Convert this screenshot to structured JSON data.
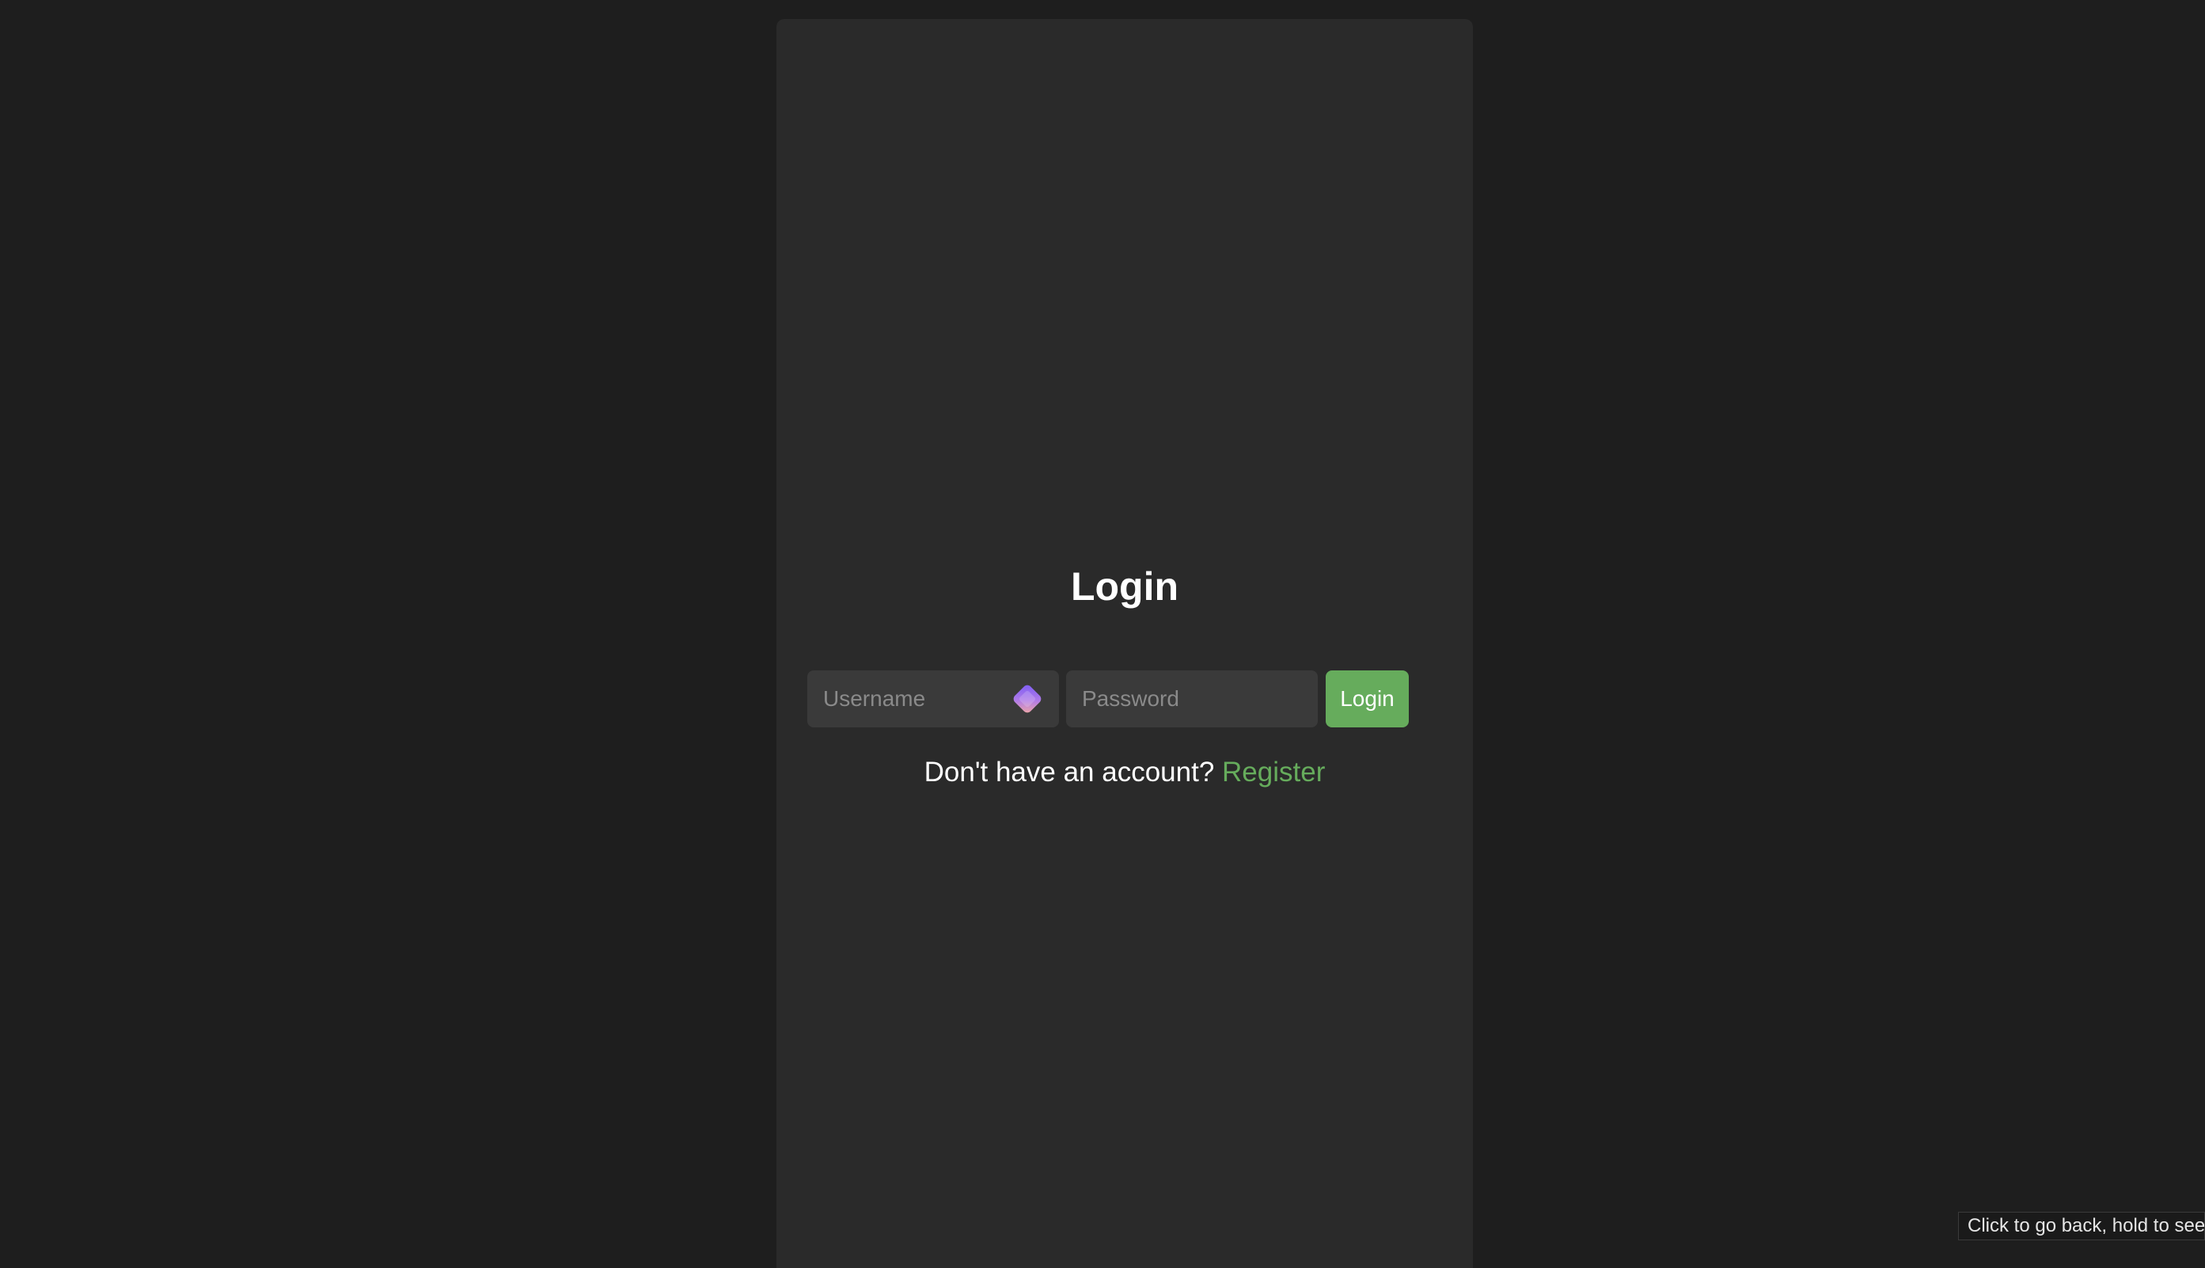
{
  "login": {
    "title": "Login",
    "username_placeholder": "Username",
    "password_placeholder": "Password",
    "submit_label": "Login",
    "register_prompt": "Don't have an account?",
    "register_link": "Register",
    "username_addon_icon": "password-manager-icon"
  },
  "tooltip": {
    "text": "Click to go back, hold to see"
  },
  "colors": {
    "page_background": "#1e1e1e",
    "panel_background": "#2a2a2a",
    "input_background": "#3a3a3a",
    "accent_green": "#66ac5c",
    "text_primary": "#ffffff",
    "placeholder_text": "#8a8a8a"
  }
}
